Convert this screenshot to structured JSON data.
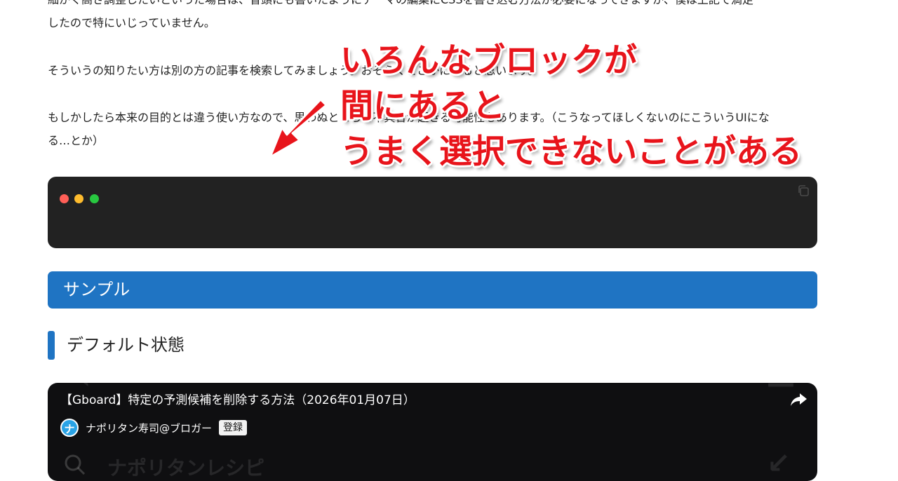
{
  "article": {
    "para_top_line1": "細かく高さ調整したいといった場合は、冒頭にも書いたようにテーマの編集にCSSを書き込む方法が必要になってきますが、僕は上記で満足",
    "para_top_line2": "したので特にいじっていません。",
    "para_2": "そういうの知りたい方は別の方の記事を検索してみましょう。おそらくどこかにあると思います。",
    "para_3_line1": "もしかしたら本来の目的とは違う使い方なので、思わぬところで不具合が起きる可能性もあります。（こうなってほしくないのにこういうUIにな",
    "para_3_line2": "る…とか）",
    "heading_h2": "サンプル",
    "heading_h3": "デフォルト状態"
  },
  "video": {
    "title": "【Gboard】特定の予測候補を削除する方法（2026年01月07日）",
    "avatar_letter": "ナ",
    "channel": "ナポリタン寿司@ブロガー",
    "subscribe": "登録",
    "bg_text": "ナポリタンレシピ"
  },
  "overlay": {
    "line1": "いろんなブロックが",
    "line2": "間にあると",
    "line3": "うまく選択できないことがある"
  },
  "colors": {
    "accent": "#1f74c3",
    "overlay_red": "#e8141b",
    "code_bg": "#222222"
  }
}
